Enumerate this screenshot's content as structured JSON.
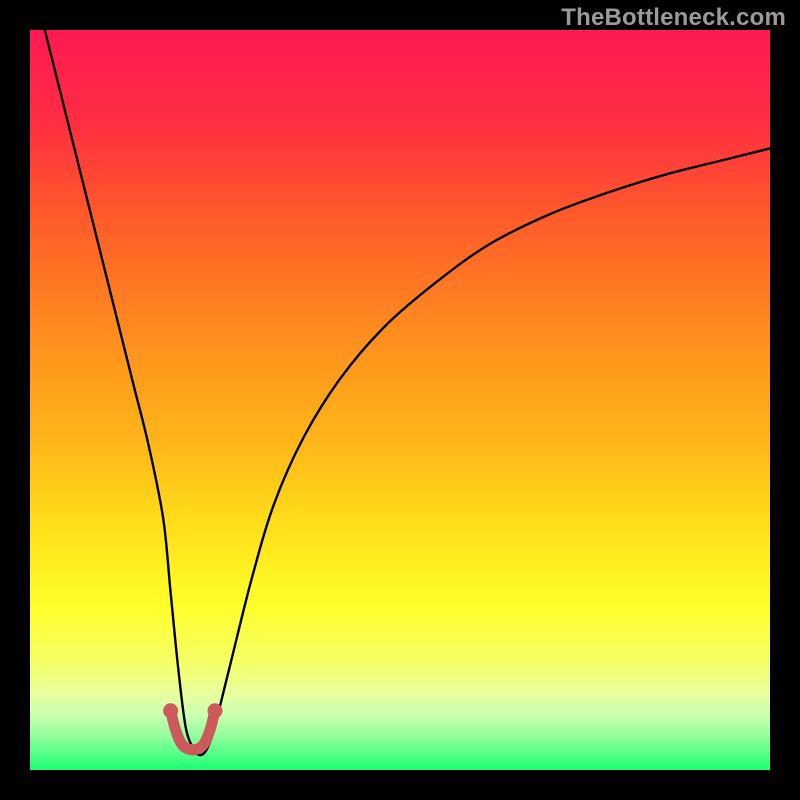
{
  "watermark": "TheBottleneck.com",
  "chart_data": {
    "type": "line",
    "title": "",
    "xlabel": "",
    "ylabel": "",
    "xlim": [
      0,
      100
    ],
    "ylim": [
      0,
      100
    ],
    "grid": false,
    "legend": false,
    "gradient_stops": [
      {
        "pos": 0.0,
        "color": "#ff1a52"
      },
      {
        "pos": 0.12,
        "color": "#ff2d42"
      },
      {
        "pos": 0.25,
        "color": "#ff5a2a"
      },
      {
        "pos": 0.4,
        "color": "#ff8a1f"
      },
      {
        "pos": 0.55,
        "color": "#ffb41a"
      },
      {
        "pos": 0.68,
        "color": "#ffe21a"
      },
      {
        "pos": 0.78,
        "color": "#ffff2a"
      },
      {
        "pos": 0.86,
        "color": "#f4ff6a"
      },
      {
        "pos": 0.9,
        "color": "#e8ffa0"
      },
      {
        "pos": 0.93,
        "color": "#c8ffb0"
      },
      {
        "pos": 0.96,
        "color": "#8aff9a"
      },
      {
        "pos": 1.0,
        "color": "#22ff77"
      }
    ],
    "series": [
      {
        "name": "bottleneck-curve",
        "color": "#000000",
        "x": [
          2,
          4,
          6,
          8,
          10,
          12,
          14,
          16,
          18,
          19,
          20,
          21,
          22,
          23,
          24,
          25,
          27,
          30,
          33,
          37,
          42,
          48,
          55,
          62,
          70,
          78,
          86,
          94,
          100
        ],
        "y": [
          100,
          92,
          84,
          76,
          68,
          60,
          52,
          44,
          34,
          24,
          14,
          6,
          3,
          2,
          3,
          6,
          14,
          26,
          36,
          45,
          53,
          60,
          66,
          71,
          75,
          78,
          80.5,
          82.5,
          84
        ]
      },
      {
        "name": "highlight-zone",
        "color": "#cc5a5a",
        "x": [
          19.0,
          19.5,
          20.0,
          20.5,
          21.0,
          21.5,
          22.0,
          22.5,
          23.0,
          23.5,
          24.0,
          24.5,
          25.0
        ],
        "y": [
          8.0,
          6.0,
          4.5,
          3.5,
          3.0,
          2.8,
          2.7,
          2.8,
          3.0,
          3.5,
          4.5,
          6.0,
          8.0
        ]
      }
    ],
    "highlight_endpoints": [
      {
        "x": 19.0,
        "y": 8.0
      },
      {
        "x": 25.0,
        "y": 8.0
      }
    ],
    "optimum_x_approx": 22.0
  }
}
